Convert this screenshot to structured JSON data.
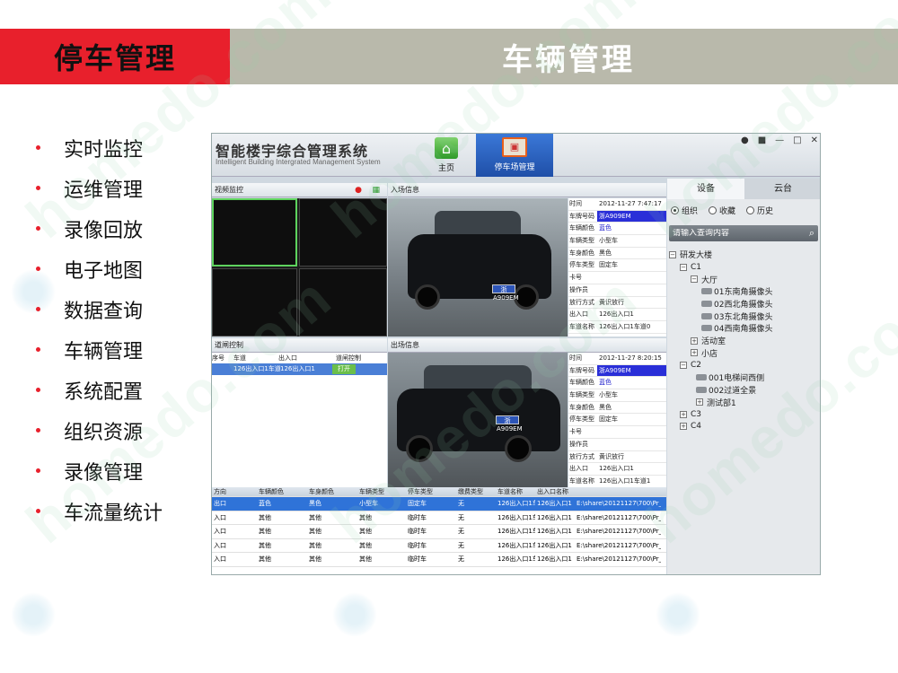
{
  "slide": {
    "section_label": "停车管理",
    "title": "车辆管理",
    "bullets": [
      "实时监控",
      "运维管理",
      "录像回放",
      "电子地图",
      "数据查询",
      "车辆管理",
      "系统配置",
      "组织资源",
      "录像管理",
      "车流量统计"
    ]
  },
  "watermark": "homedo.com",
  "app": {
    "title": "智能楼宇综合管理系统",
    "subtitle": "Intelligent Building Intergrated Management System",
    "nav": {
      "home": "主页",
      "parking": "停车场管理"
    },
    "video_panel": {
      "title": "视频监控"
    },
    "gate_panel": {
      "title": "道闸控制",
      "columns": [
        "序号",
        "车道",
        "出入口",
        "道闸控制"
      ],
      "row": {
        "index": "",
        "lane": "126出入口1车道1",
        "gate": "126出入口1",
        "action": "打开"
      }
    },
    "entry": {
      "title": "入场信息",
      "fields": [
        {
          "k": "时间",
          "v": "2012-11-27 7:47:17"
        },
        {
          "k": "车牌号码",
          "v": "浙A909EM",
          "hl": true
        },
        {
          "k": "车辆颜色",
          "v": "蓝色"
        },
        {
          "k": "车辆类型",
          "v": "小型车"
        },
        {
          "k": "车身颜色",
          "v": "黑色"
        },
        {
          "k": "停车类型",
          "v": "固定车"
        },
        {
          "k": "卡号",
          "v": ""
        },
        {
          "k": "操作员",
          "v": ""
        },
        {
          "k": "放行方式",
          "v": "黄识放行"
        },
        {
          "k": "出入口",
          "v": "126出入口1"
        },
        {
          "k": "车道名称",
          "v": "126出入口1车道0"
        }
      ],
      "plate_text": "浙A909EM"
    },
    "exit": {
      "title": "出场信息",
      "fields": [
        {
          "k": "时间",
          "v": "2012-11-27 8:20:15"
        },
        {
          "k": "车牌号码",
          "v": "浙A909EM",
          "hl": true
        },
        {
          "k": "车辆颜色",
          "v": "蓝色"
        },
        {
          "k": "车辆类型",
          "v": "小型车"
        },
        {
          "k": "车身颜色",
          "v": "黑色"
        },
        {
          "k": "停车类型",
          "v": "固定车"
        },
        {
          "k": "卡号",
          "v": ""
        },
        {
          "k": "操作员",
          "v": ""
        },
        {
          "k": "放行方式",
          "v": "黄识放行"
        },
        {
          "k": "出入口",
          "v": "126出入口1"
        },
        {
          "k": "车道名称",
          "v": "126出入口1车道1"
        }
      ],
      "plate_text": "浙A909EM"
    },
    "table": {
      "headers": [
        "方向",
        "车辆颜色",
        "车身颜色",
        "车辆类型",
        "停车类型",
        "缴费类型",
        "车道名称",
        "出入口名称",
        ""
      ],
      "rows": [
        [
          "出口",
          "蓝色",
          "黑色",
          "小型车",
          "固定车",
          "无",
          "126出入口1车道1",
          "126出入口1",
          "E:\\share\\20121127\\700\\Pr_C"
        ],
        [
          "入口",
          "其他",
          "其他",
          "其他",
          "临时车",
          "无",
          "126出入口1车道1",
          "126出入口1",
          "E:\\share\\20121127\\700\\Pr_C"
        ],
        [
          "入口",
          "其他",
          "其他",
          "其他",
          "临时车",
          "无",
          "126出入口1车道1",
          "126出入口1",
          "E:\\share\\20121127\\700\\Pr_C"
        ],
        [
          "入口",
          "其他",
          "其他",
          "其他",
          "临时车",
          "无",
          "126出入口1车道1",
          "126出入口1",
          "E:\\share\\20121127\\700\\Pr_C"
        ],
        [
          "入口",
          "其他",
          "其他",
          "其他",
          "临时车",
          "无",
          "126出入口1车道1",
          "126出入口1",
          "E:\\share\\20121127\\700\\Pr_C"
        ]
      ]
    },
    "right_panel": {
      "tabs": [
        "设备",
        "云台"
      ],
      "radios": [
        "组织",
        "收藏",
        "历史"
      ],
      "search_placeholder": "请输入查询内容",
      "tree": {
        "root": "研发大楼",
        "c1": "C1",
        "hall": "大厅",
        "cams": [
          "01东南角摄像头",
          "02西北角摄像头",
          "03东北角摄像头",
          "04西南角摄像头"
        ],
        "activity": "活动室",
        "shop": "小店",
        "c2": "C2",
        "c2_cams": [
          "001电梯间西侧",
          "002过道全景"
        ],
        "test": "测试部1",
        "c3": "C3",
        "c4": "C4"
      }
    }
  },
  "colors": {
    "accent": "#e8202c",
    "header_gray": "#b9b9ab",
    "selection": "#2f73d8"
  }
}
